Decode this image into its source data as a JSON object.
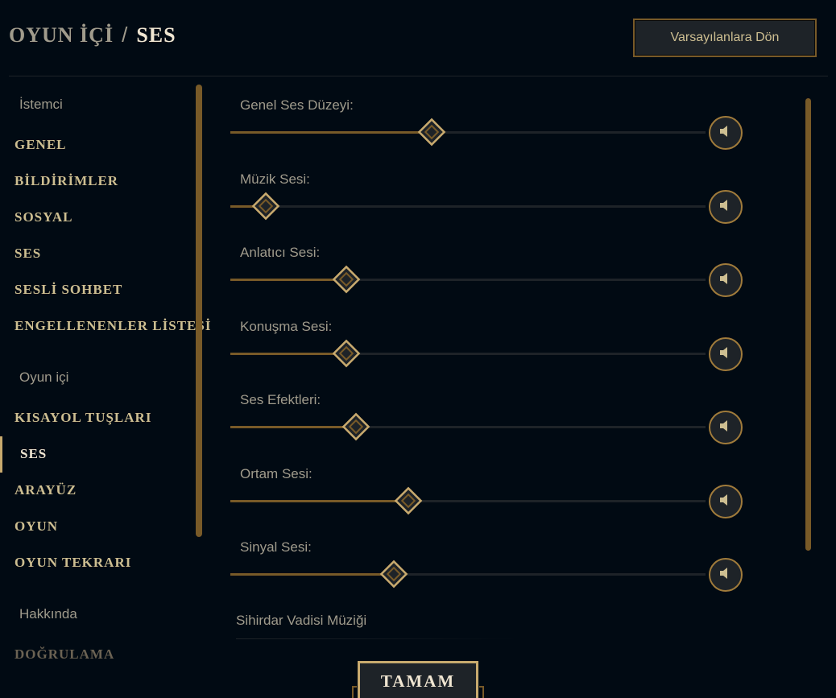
{
  "header": {
    "breadcrumb_parent": "OYUN İÇİ",
    "breadcrumb_separator": "/",
    "breadcrumb_current": "SES",
    "reset_button_label": "Varsayılanlara Dön"
  },
  "sidebar": {
    "groups": [
      {
        "title": "İstemci",
        "items": [
          "GENEL",
          "BİLDİRİMLER",
          "SOSYAL",
          "SES",
          "SESLİ SOHBET",
          "ENGELLENENLER LİSTESİ"
        ]
      },
      {
        "title": "Oyun içi",
        "items": [
          "KISAYOL TUŞLARI",
          "SES",
          "ARAYÜZ",
          "OYUN",
          "OYUN TEKRARI"
        ]
      },
      {
        "title": "Hakkında",
        "items": [
          "DOĞRULAMA"
        ]
      }
    ],
    "active_item": "Oyun içi / SES"
  },
  "sliders": [
    {
      "label": "Genel Ses Düzeyi:",
      "value": 39,
      "muted": false
    },
    {
      "label": "Müzik Sesi:",
      "value": 4,
      "muted": false
    },
    {
      "label": "Anlatıcı Sesi:",
      "value": 21,
      "muted": false
    },
    {
      "label": "Konuşma Sesi:",
      "value": 21,
      "muted": false
    },
    {
      "label": "Ses Efektleri:",
      "value": 23,
      "muted": false
    },
    {
      "label": "Ortam Sesi:",
      "value": 34,
      "muted": false
    },
    {
      "label": "Sinyal Sesi:",
      "value": 31,
      "muted": false
    }
  ],
  "next_section": {
    "title": "Sihirdar Vadisi Müziği"
  },
  "footer": {
    "ok_button_label": "TAMAM"
  },
  "icons": {
    "mute_button": "speaker-icon",
    "slider_thumb": "diamond-thumb-icon"
  },
  "colors": {
    "background": "#010a13",
    "gold": "#c8aa6e",
    "gold_dark": "#785a28",
    "text_light": "#f0e6d2",
    "text_muted": "#a09b8c"
  }
}
